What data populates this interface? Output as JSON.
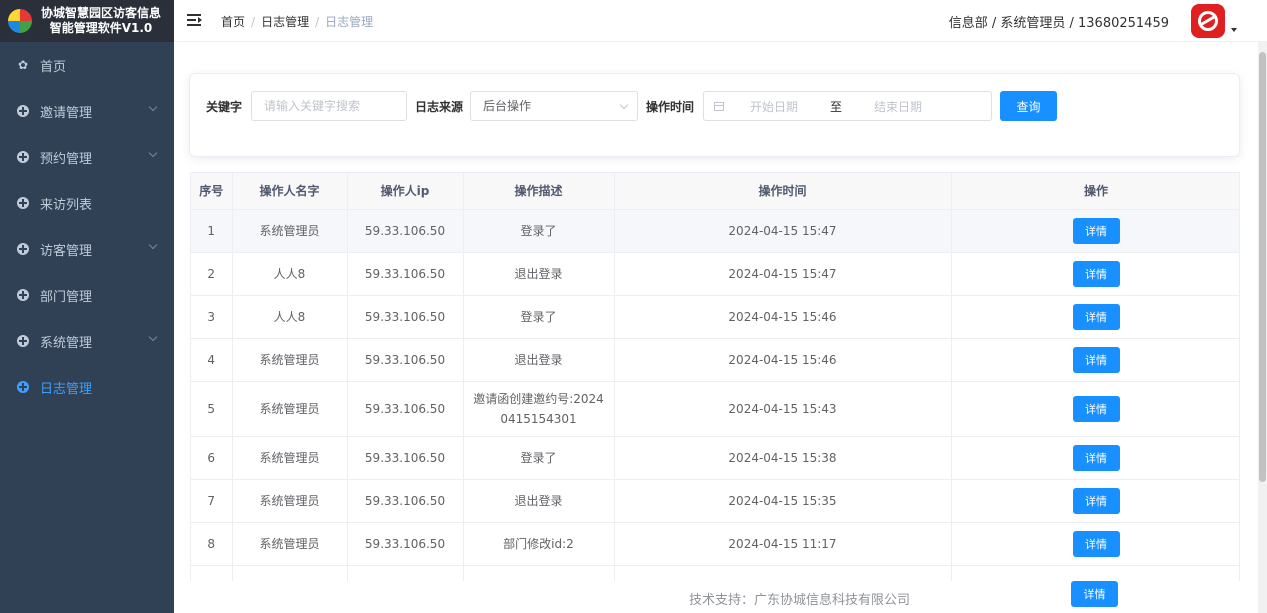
{
  "app": {
    "title_line1": "协城智慧园区访客信息",
    "title_line2": "智能管理软件V1.0"
  },
  "sidebar": {
    "items": [
      {
        "label": "首页",
        "icon": "dashboard-icon",
        "expandable": false,
        "active": false
      },
      {
        "label": "邀请管理",
        "icon": "plus-circle-icon",
        "expandable": true,
        "active": false
      },
      {
        "label": "预约管理",
        "icon": "plus-circle-icon",
        "expandable": true,
        "active": false
      },
      {
        "label": "来访列表",
        "icon": "plus-circle-icon",
        "expandable": false,
        "active": false
      },
      {
        "label": "访客管理",
        "icon": "plus-circle-icon",
        "expandable": true,
        "active": false
      },
      {
        "label": "部门管理",
        "icon": "plus-circle-icon",
        "expandable": false,
        "active": false
      },
      {
        "label": "系统管理",
        "icon": "plus-circle-icon",
        "expandable": true,
        "active": false
      },
      {
        "label": "日志管理",
        "icon": "plus-circle-icon",
        "expandable": false,
        "active": true
      }
    ]
  },
  "header": {
    "breadcrumb": [
      "首页",
      "日志管理",
      "日志管理"
    ],
    "user_info": "信息部 / 系统管理员 / 13680251459"
  },
  "search": {
    "keyword_label": "关键字",
    "keyword_placeholder": "请输入关键字搜索",
    "source_label": "日志来源",
    "source_value": "后台操作",
    "time_label": "操作时间",
    "start_placeholder": "开始日期",
    "range_sep": "至",
    "end_placeholder": "结束日期",
    "query_button": "查询"
  },
  "table": {
    "columns": [
      "序号",
      "操作人名字",
      "操作人ip",
      "操作描述",
      "操作时间",
      "操作"
    ],
    "detail_label": "详情",
    "rows": [
      {
        "no": "1",
        "name": "系统管理员",
        "ip": "59.33.106.50",
        "desc": "登录了",
        "time": "2024-04-15 15:47"
      },
      {
        "no": "2",
        "name": "人人8",
        "ip": "59.33.106.50",
        "desc": "退出登录",
        "time": "2024-04-15 15:47"
      },
      {
        "no": "3",
        "name": "人人8",
        "ip": "59.33.106.50",
        "desc": "登录了",
        "time": "2024-04-15 15:46"
      },
      {
        "no": "4",
        "name": "系统管理员",
        "ip": "59.33.106.50",
        "desc": "退出登录",
        "time": "2024-04-15 15:46"
      },
      {
        "no": "5",
        "name": "系统管理员",
        "ip": "59.33.106.50",
        "desc": "邀请函创建邀约号:20240415154301",
        "time": "2024-04-15 15:43"
      },
      {
        "no": "6",
        "name": "系统管理员",
        "ip": "59.33.106.50",
        "desc": "登录了",
        "time": "2024-04-15 15:38"
      },
      {
        "no": "7",
        "name": "系统管理员",
        "ip": "59.33.106.50",
        "desc": "退出登录",
        "time": "2024-04-15 15:35"
      },
      {
        "no": "8",
        "name": "系统管理员",
        "ip": "59.33.106.50",
        "desc": "部门修改id:2",
        "time": "2024-04-15 11:17"
      },
      {
        "no": "",
        "name": "",
        "ip": "",
        "desc": "",
        "time": ""
      }
    ]
  },
  "footer": {
    "text": "技术支持：广东协城信息科技有限公司"
  },
  "colors": {
    "sidebar_bg": "#304156",
    "accent": "#1890ff",
    "active_menu": "#409eff",
    "avatar_bg": "#e02020"
  }
}
